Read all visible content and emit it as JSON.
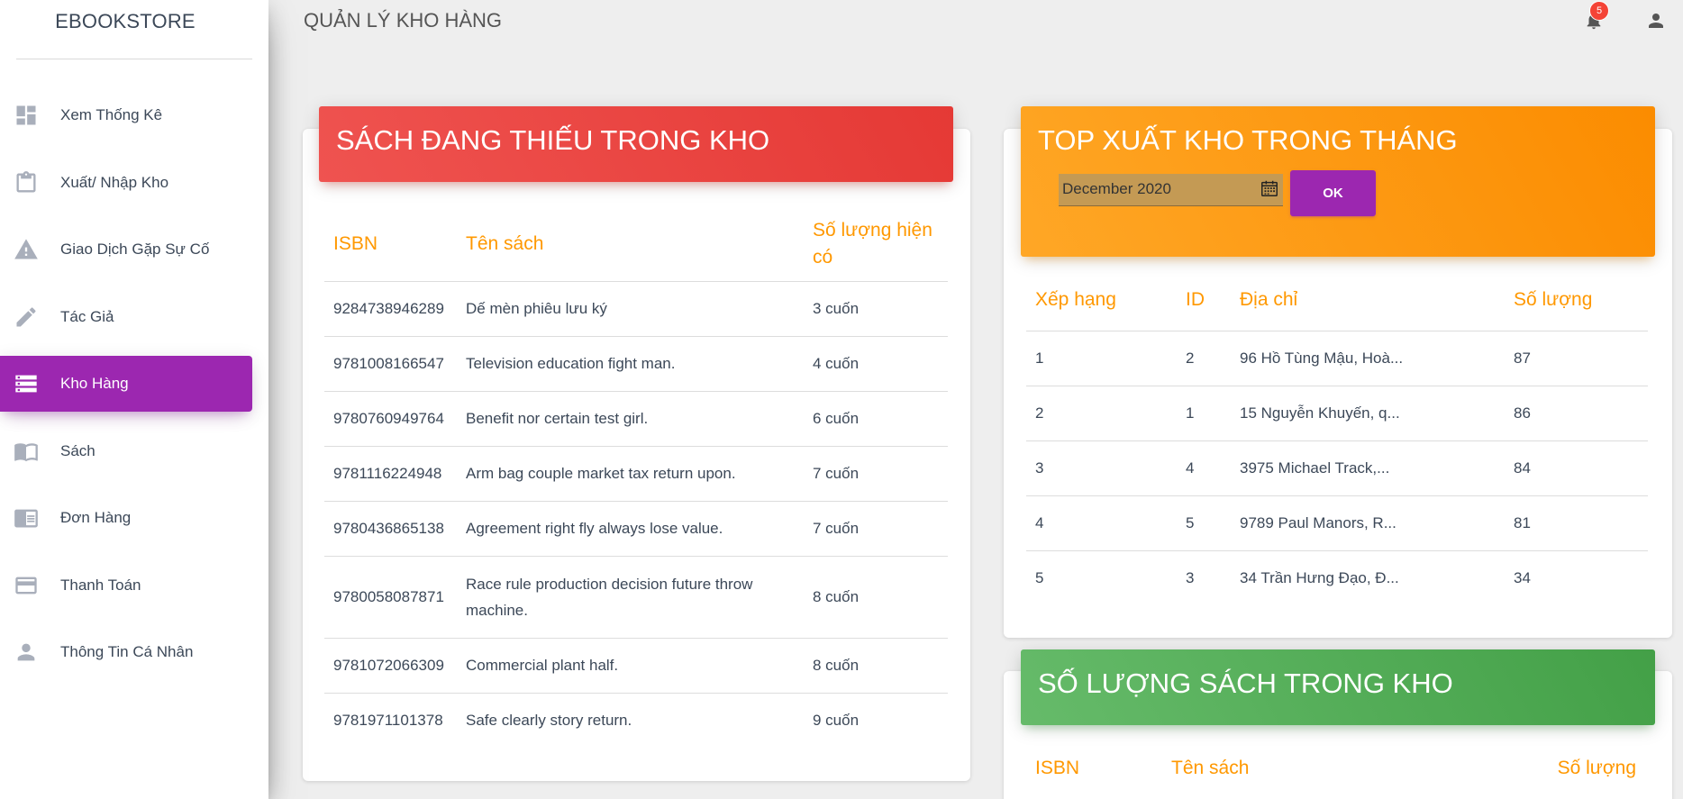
{
  "app": {
    "brand": "EBOOKSTORE",
    "page_title": "QUẢN LÝ KHO HÀNG"
  },
  "header": {
    "notification_count": "5",
    "icons": [
      "bell-icon",
      "account-icon"
    ]
  },
  "sidebar": {
    "items": [
      {
        "label": "Xem Thống Kê",
        "icon": "dashboard-icon",
        "active": false
      },
      {
        "label": "Xuất/ Nhập Kho",
        "icon": "clipboard-icon",
        "active": false
      },
      {
        "label": "Giao Dịch Gặp Sự Cố",
        "icon": "warning-icon",
        "active": false
      },
      {
        "label": "Tác Giả",
        "icon": "pencil-icon",
        "active": false
      },
      {
        "label": "Kho Hàng",
        "icon": "storage-icon",
        "active": true
      },
      {
        "label": "Sách",
        "icon": "book-icon",
        "active": false
      },
      {
        "label": "Đơn Hàng",
        "icon": "chrome-reader-icon",
        "active": false
      },
      {
        "label": "Thanh Toán",
        "icon": "credit-card-icon",
        "active": false
      },
      {
        "label": "Thông Tin Cá Nhân",
        "icon": "person-icon",
        "active": false
      }
    ]
  },
  "missing_books": {
    "title": "SÁCH ĐANG THIẾU TRONG KHO",
    "columns": [
      "ISBN",
      "Tên sách",
      "Số lượng hiện có"
    ],
    "rows": [
      {
        "isbn": "9284738946289",
        "name": "Dế mèn phiêu lưu ký",
        "qty": "3 cuốn"
      },
      {
        "isbn": "9781008166547",
        "name": "Television education fight man.",
        "qty": "4 cuốn"
      },
      {
        "isbn": "9780760949764",
        "name": "Benefit nor certain test girl.",
        "qty": "6 cuốn"
      },
      {
        "isbn": "9781116224948",
        "name": "Arm bag couple market tax return upon.",
        "qty": "7 cuốn"
      },
      {
        "isbn": "9780436865138",
        "name": "Agreement right fly always lose value.",
        "qty": "7 cuốn"
      },
      {
        "isbn": "9780058087871",
        "name": "Race rule production decision future throw machine.",
        "qty": "8 cuốn"
      },
      {
        "isbn": "9781072066309",
        "name": "Commercial plant half.",
        "qty": "8 cuốn"
      },
      {
        "isbn": "9781971101378",
        "name": "Safe clearly story return.",
        "qty": "9 cuốn"
      }
    ]
  },
  "top_export": {
    "title": "TOP XUẤT KHO TRONG THÁNG",
    "month_value": "December  2020",
    "ok_label": "OK",
    "columns": [
      "Xếp hạng",
      "ID",
      "Địa chỉ",
      "Số lượng"
    ],
    "rows": [
      {
        "rank": "1",
        "id": "2",
        "address": "96 Hồ Tùng Mậu, Hoà...",
        "qty": "87"
      },
      {
        "rank": "2",
        "id": "1",
        "address": "15 Nguyễn Khuyến, q...",
        "qty": "86"
      },
      {
        "rank": "3",
        "id": "4",
        "address": "3975 Michael Track,...",
        "qty": "84"
      },
      {
        "rank": "4",
        "id": "5",
        "address": "9789 Paul Manors, R...",
        "qty": "81"
      },
      {
        "rank": "5",
        "id": "3",
        "address": "34 Trần Hưng Đạo, Đ...",
        "qty": "34"
      }
    ]
  },
  "stock_count": {
    "title": "SỐ LƯỢNG SÁCH TRONG KHO",
    "columns": [
      "ISBN",
      "Tên sách",
      "Số lượng"
    ]
  },
  "colors": {
    "active_purple": "#9c27b0",
    "header_red": "#e53935",
    "header_orange": "#fb8c00",
    "header_green": "#43a047",
    "table_header_orange": "#ff9800",
    "badge_red": "#f44336"
  }
}
